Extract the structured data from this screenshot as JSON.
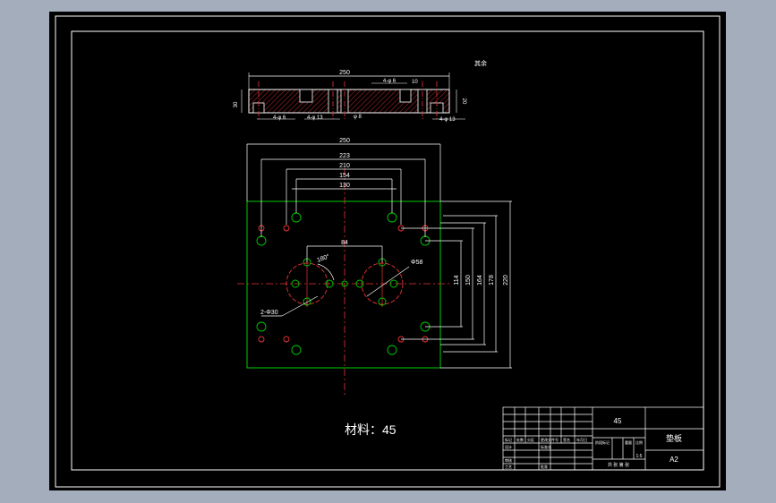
{
  "drawing": {
    "material_label": "材料：45",
    "top_note": "其余",
    "section_view": {
      "overall_width": "250",
      "hole_callout_top": "4-φ 6",
      "hole_callout_bottom_left": "4-φ 6",
      "hole_callout_bottom_mid": "4-φ 13",
      "hole_callout_center": "φ 8",
      "hole_callout_right": "4-φ 13",
      "thickness": "30",
      "dim_right": "20",
      "dim_small_top": "10"
    },
    "plan_view": {
      "dims_horizontal": [
        "250",
        "223",
        "210",
        "154",
        "130"
      ],
      "center_spacing": "84",
      "angle_label": "180°",
      "hole_dia_right": "Φ58",
      "hole_dia_left": "2-Φ30",
      "dims_vertical": [
        "114",
        "150",
        "164",
        "178",
        "220"
      ]
    }
  },
  "title_block": {
    "material": "45",
    "part_name": "垫板",
    "scale": "A2",
    "ratio": "1:5",
    "sheet_footer": "共 张  第 张",
    "label_standardization": "标准化",
    "label_stage": "阶段标记",
    "label_weight": "重量",
    "label_ratio": "比例",
    "label_designer": "设计",
    "label_reviewer": "审核",
    "label_process": "工艺",
    "label_approve": "批准",
    "label_mark": "标记",
    "label_place": "处数",
    "label_division": "分区",
    "label_doc": "更改文件号",
    "label_sign": "签名",
    "label_date": "年月日"
  }
}
